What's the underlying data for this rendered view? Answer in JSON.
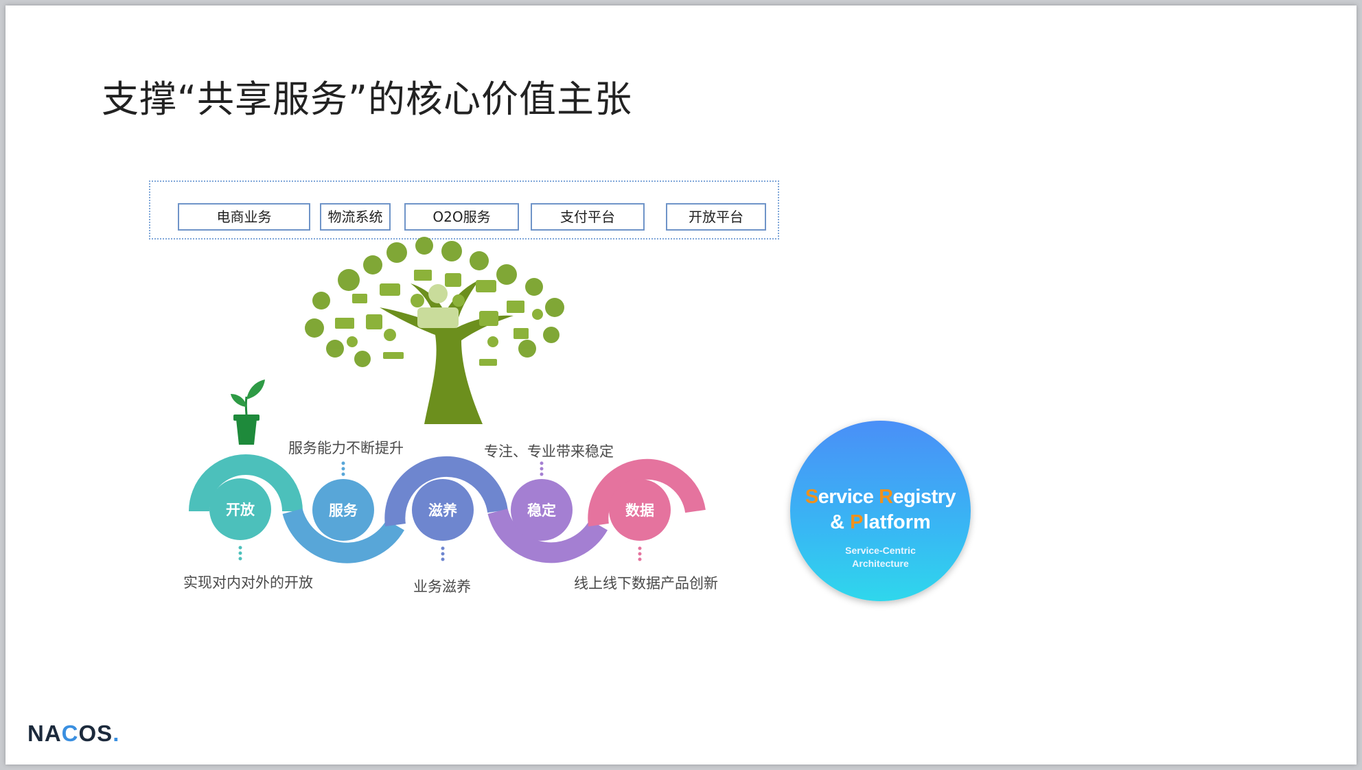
{
  "slide_title": "支撑“共享服务”的核心价值主张",
  "business_units": [
    "电商业务",
    "物流系统",
    "O2O服务",
    "支付平台",
    "开放平台"
  ],
  "stages": [
    {
      "label": "开放",
      "caption": "实现对内对外的开放",
      "color": "#4cc0bb"
    },
    {
      "label": "服务",
      "caption": "服务能力不断提升",
      "color": "#58a6d8"
    },
    {
      "label": "滋养",
      "caption": "业务滋养",
      "color": "#6e86cf"
    },
    {
      "label": "稳定",
      "caption": "专注、专业带来稳定",
      "color": "#a47fd2"
    },
    {
      "label": "数据",
      "caption": "线上线下数据产品创新",
      "color": "#e5739e"
    }
  ],
  "registry": {
    "line1_a": "S",
    "line1_b": "ervice ",
    "line1_c": "R",
    "line1_d": "egistry",
    "line2_a": "& ",
    "line2_b": "P",
    "line2_c": "latform",
    "subtitle_1": "Service-Centric",
    "subtitle_2": "Architecture"
  },
  "logo": {
    "a": "NA",
    "b": "C",
    "c": "OS",
    "d": "."
  },
  "colors": {
    "tree": "#6e9a2c",
    "trunk": "#6c8f1d",
    "pot": "#1e8a3b"
  }
}
